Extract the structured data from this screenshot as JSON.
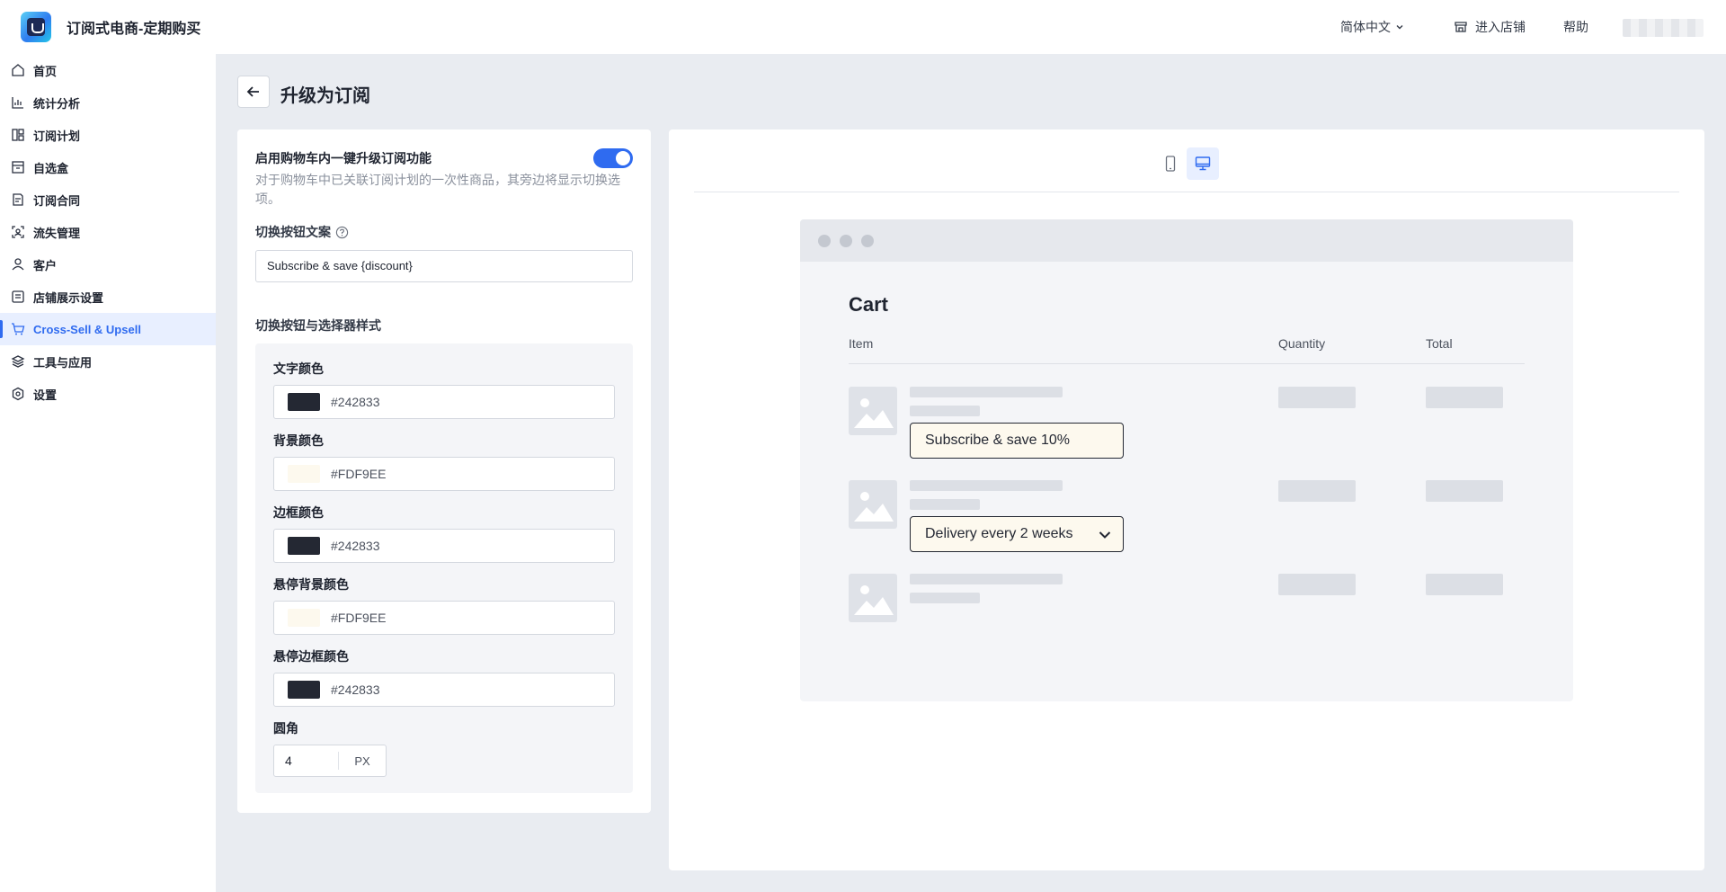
{
  "header": {
    "app_title": "订阅式电商-定期购买",
    "language": "简体中文",
    "enter_store": "进入店铺",
    "help": "帮助"
  },
  "sidebar": {
    "items": [
      {
        "label": "首页",
        "icon": "home-icon"
      },
      {
        "label": "统计分析",
        "icon": "chart-icon"
      },
      {
        "label": "订阅计划",
        "icon": "plan-icon"
      },
      {
        "label": "自选盒",
        "icon": "box-icon"
      },
      {
        "label": "订阅合同",
        "icon": "contract-icon"
      },
      {
        "label": "流失管理",
        "icon": "churn-icon"
      },
      {
        "label": "客户",
        "icon": "user-icon"
      },
      {
        "label": "店铺展示设置",
        "icon": "display-icon"
      },
      {
        "label": "Cross-Sell & Upsell",
        "icon": "cart-icon",
        "active": true
      },
      {
        "label": "工具与应用",
        "icon": "layers-icon"
      },
      {
        "label": "设置",
        "icon": "settings-icon"
      }
    ]
  },
  "page": {
    "title": "升级为订阅"
  },
  "settings": {
    "enable_label": "启用购物车内一键升级订阅功能",
    "enable_on": true,
    "enable_desc": "对于购物车中已关联订阅计划的一次性商品，其旁边将显示切换选项。",
    "toggle_text_label": "切换按钮文案",
    "toggle_text_value": "Subscribe & save {discount}",
    "style_label": "切换按钮与选择器样式",
    "colors": {
      "text": {
        "label": "文字颜色",
        "value": "#242833"
      },
      "background": {
        "label": "背景颜色",
        "value": "#FDF9EE"
      },
      "border": {
        "label": "边框颜色",
        "value": "#242833"
      },
      "hover_background": {
        "label": "悬停背景颜色",
        "value": "#FDF9EE"
      },
      "hover_border": {
        "label": "悬停边框颜色",
        "value": "#242833"
      }
    },
    "radius": {
      "label": "圆角",
      "value": "4",
      "unit": "PX"
    }
  },
  "preview": {
    "active_device": "desktop",
    "cart_title": "Cart",
    "columns": {
      "item": "Item",
      "quantity": "Quantity",
      "total": "Total"
    },
    "subscribe_button": "Subscribe & save 10%",
    "delivery_select": "Delivery every 2 weeks"
  }
}
